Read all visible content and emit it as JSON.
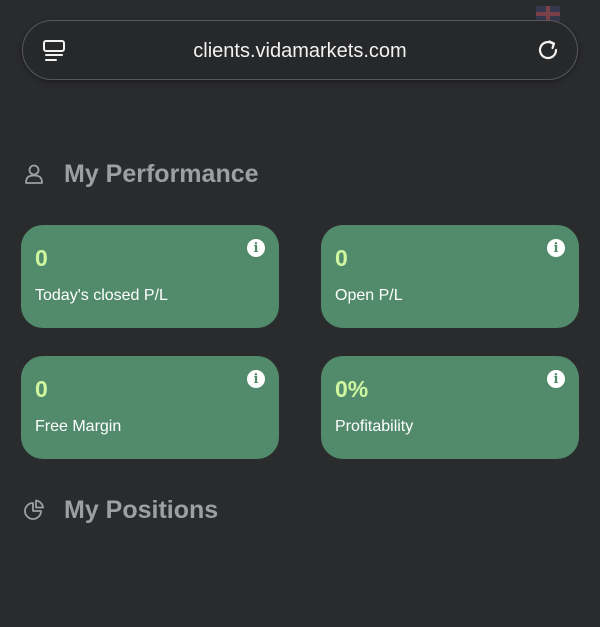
{
  "browser": {
    "url": "clients.vidamarkets.com"
  },
  "performance": {
    "title": "My Performance",
    "cards": [
      {
        "value": "0",
        "label": "Today's closed P/L"
      },
      {
        "value": "0",
        "label": "Open P/L"
      },
      {
        "value": "0",
        "label": "Free Margin"
      },
      {
        "value": "0%",
        "label": "Profitability"
      }
    ]
  },
  "positions": {
    "title": "My Positions"
  },
  "colors": {
    "background": "#2a2b2d",
    "card": "#528a6c",
    "card_value": "#cef79f",
    "section_title": "#9d9fa4"
  },
  "icons": {
    "tabs": "tabs-icon",
    "reload": "reload-icon",
    "user": "user-icon",
    "info": "info-icon",
    "pie": "pie-chart-icon"
  }
}
